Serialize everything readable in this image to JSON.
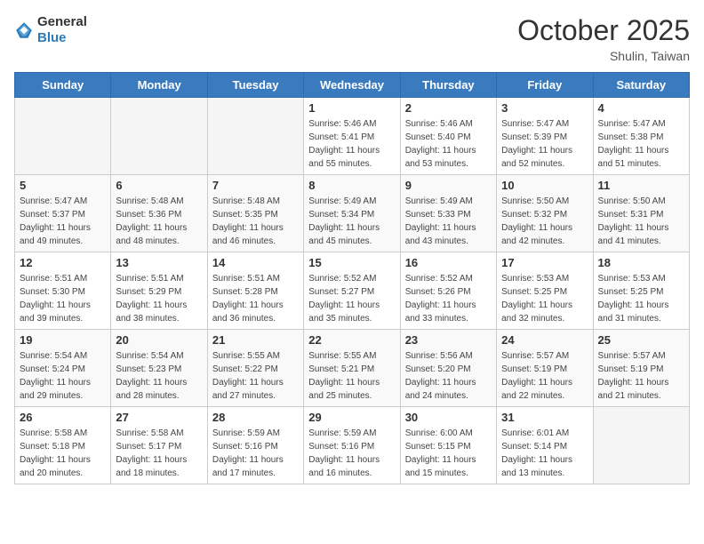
{
  "header": {
    "logo_general": "General",
    "logo_blue": "Blue",
    "month_title": "October 2025",
    "subtitle": "Shulin, Taiwan"
  },
  "days_of_week": [
    "Sunday",
    "Monday",
    "Tuesday",
    "Wednesday",
    "Thursday",
    "Friday",
    "Saturday"
  ],
  "weeks": [
    [
      {
        "day": "",
        "info": ""
      },
      {
        "day": "",
        "info": ""
      },
      {
        "day": "",
        "info": ""
      },
      {
        "day": "1",
        "info": "Sunrise: 5:46 AM\nSunset: 5:41 PM\nDaylight: 11 hours\nand 55 minutes."
      },
      {
        "day": "2",
        "info": "Sunrise: 5:46 AM\nSunset: 5:40 PM\nDaylight: 11 hours\nand 53 minutes."
      },
      {
        "day": "3",
        "info": "Sunrise: 5:47 AM\nSunset: 5:39 PM\nDaylight: 11 hours\nand 52 minutes."
      },
      {
        "day": "4",
        "info": "Sunrise: 5:47 AM\nSunset: 5:38 PM\nDaylight: 11 hours\nand 51 minutes."
      }
    ],
    [
      {
        "day": "5",
        "info": "Sunrise: 5:47 AM\nSunset: 5:37 PM\nDaylight: 11 hours\nand 49 minutes."
      },
      {
        "day": "6",
        "info": "Sunrise: 5:48 AM\nSunset: 5:36 PM\nDaylight: 11 hours\nand 48 minutes."
      },
      {
        "day": "7",
        "info": "Sunrise: 5:48 AM\nSunset: 5:35 PM\nDaylight: 11 hours\nand 46 minutes."
      },
      {
        "day": "8",
        "info": "Sunrise: 5:49 AM\nSunset: 5:34 PM\nDaylight: 11 hours\nand 45 minutes."
      },
      {
        "day": "9",
        "info": "Sunrise: 5:49 AM\nSunset: 5:33 PM\nDaylight: 11 hours\nand 43 minutes."
      },
      {
        "day": "10",
        "info": "Sunrise: 5:50 AM\nSunset: 5:32 PM\nDaylight: 11 hours\nand 42 minutes."
      },
      {
        "day": "11",
        "info": "Sunrise: 5:50 AM\nSunset: 5:31 PM\nDaylight: 11 hours\nand 41 minutes."
      }
    ],
    [
      {
        "day": "12",
        "info": "Sunrise: 5:51 AM\nSunset: 5:30 PM\nDaylight: 11 hours\nand 39 minutes."
      },
      {
        "day": "13",
        "info": "Sunrise: 5:51 AM\nSunset: 5:29 PM\nDaylight: 11 hours\nand 38 minutes."
      },
      {
        "day": "14",
        "info": "Sunrise: 5:51 AM\nSunset: 5:28 PM\nDaylight: 11 hours\nand 36 minutes."
      },
      {
        "day": "15",
        "info": "Sunrise: 5:52 AM\nSunset: 5:27 PM\nDaylight: 11 hours\nand 35 minutes."
      },
      {
        "day": "16",
        "info": "Sunrise: 5:52 AM\nSunset: 5:26 PM\nDaylight: 11 hours\nand 33 minutes."
      },
      {
        "day": "17",
        "info": "Sunrise: 5:53 AM\nSunset: 5:25 PM\nDaylight: 11 hours\nand 32 minutes."
      },
      {
        "day": "18",
        "info": "Sunrise: 5:53 AM\nSunset: 5:25 PM\nDaylight: 11 hours\nand 31 minutes."
      }
    ],
    [
      {
        "day": "19",
        "info": "Sunrise: 5:54 AM\nSunset: 5:24 PM\nDaylight: 11 hours\nand 29 minutes."
      },
      {
        "day": "20",
        "info": "Sunrise: 5:54 AM\nSunset: 5:23 PM\nDaylight: 11 hours\nand 28 minutes."
      },
      {
        "day": "21",
        "info": "Sunrise: 5:55 AM\nSunset: 5:22 PM\nDaylight: 11 hours\nand 27 minutes."
      },
      {
        "day": "22",
        "info": "Sunrise: 5:55 AM\nSunset: 5:21 PM\nDaylight: 11 hours\nand 25 minutes."
      },
      {
        "day": "23",
        "info": "Sunrise: 5:56 AM\nSunset: 5:20 PM\nDaylight: 11 hours\nand 24 minutes."
      },
      {
        "day": "24",
        "info": "Sunrise: 5:57 AM\nSunset: 5:19 PM\nDaylight: 11 hours\nand 22 minutes."
      },
      {
        "day": "25",
        "info": "Sunrise: 5:57 AM\nSunset: 5:19 PM\nDaylight: 11 hours\nand 21 minutes."
      }
    ],
    [
      {
        "day": "26",
        "info": "Sunrise: 5:58 AM\nSunset: 5:18 PM\nDaylight: 11 hours\nand 20 minutes."
      },
      {
        "day": "27",
        "info": "Sunrise: 5:58 AM\nSunset: 5:17 PM\nDaylight: 11 hours\nand 18 minutes."
      },
      {
        "day": "28",
        "info": "Sunrise: 5:59 AM\nSunset: 5:16 PM\nDaylight: 11 hours\nand 17 minutes."
      },
      {
        "day": "29",
        "info": "Sunrise: 5:59 AM\nSunset: 5:16 PM\nDaylight: 11 hours\nand 16 minutes."
      },
      {
        "day": "30",
        "info": "Sunrise: 6:00 AM\nSunset: 5:15 PM\nDaylight: 11 hours\nand 15 minutes."
      },
      {
        "day": "31",
        "info": "Sunrise: 6:01 AM\nSunset: 5:14 PM\nDaylight: 11 hours\nand 13 minutes."
      },
      {
        "day": "",
        "info": ""
      }
    ]
  ]
}
